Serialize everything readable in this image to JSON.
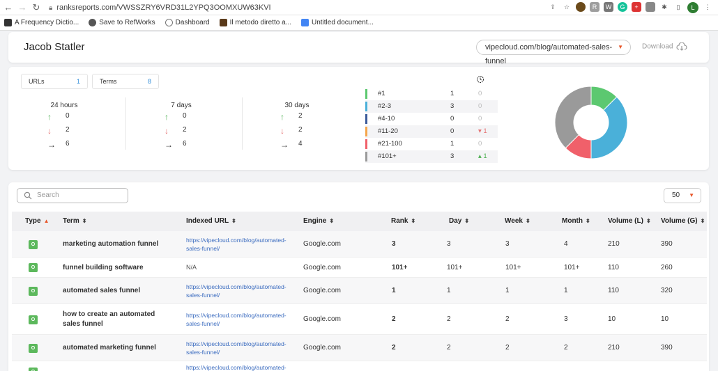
{
  "browser": {
    "url": "ranksreports.com/VWSSZRY6VRD31L2YPQ3OOMXUW63KVI",
    "bookmarks": [
      {
        "label": "A Frequency Dictio...",
        "color": "#333"
      },
      {
        "label": "Save to RefWorks",
        "color": "#555"
      },
      {
        "label": "Dashboard",
        "color": "#777"
      },
      {
        "label": "Il metodo diretto a...",
        "color": "#5a3a1a"
      },
      {
        "label": "Untitled document...",
        "color": "#4285f4"
      }
    ],
    "profile_initial": "L"
  },
  "header": {
    "client_name": "Jacob Statler",
    "url_selected": "vipecloud.com/blog/automated-sales-funnel",
    "download_label": "Download"
  },
  "summary": {
    "urls_label": "URLs",
    "urls_count": "1",
    "terms_label": "Terms",
    "terms_count": "8"
  },
  "periods": [
    {
      "title": "24 hours",
      "up": "0",
      "down": "2",
      "flat": "6"
    },
    {
      "title": "7 days",
      "up": "0",
      "down": "2",
      "flat": "6"
    },
    {
      "title": "30 days",
      "up": "2",
      "down": "2",
      "flat": "4"
    }
  ],
  "rank_buckets": [
    {
      "label": "#1",
      "count": "1",
      "change": "0",
      "dir": "none",
      "color": "#5cc870"
    },
    {
      "label": "#2-3",
      "count": "3",
      "change": "0",
      "dir": "none",
      "color": "#4ab0d9"
    },
    {
      "label": "#4-10",
      "count": "0",
      "change": "0",
      "dir": "none",
      "color": "#3b5a9a"
    },
    {
      "label": "#11-20",
      "count": "0",
      "change": "▾ 1",
      "dir": "neg",
      "color": "#f5a54a"
    },
    {
      "label": "#21-100",
      "count": "1",
      "change": "0",
      "dir": "none",
      "color": "#f0606a"
    },
    {
      "label": "#101+",
      "count": "3",
      "change": "▴ 1",
      "dir": "pos",
      "color": "#9a9a9a"
    }
  ],
  "donut": {
    "segments": [
      {
        "name": "#1",
        "value": 1,
        "color": "#5cc870"
      },
      {
        "name": "#2-3",
        "value": 3,
        "color": "#4ab0d9"
      },
      {
        "name": "#21-100",
        "value": 1,
        "color": "#f0606a"
      },
      {
        "name": "#101+",
        "value": 3,
        "color": "#9a9a9a"
      }
    ]
  },
  "table": {
    "search_placeholder": "Search",
    "per_page": "50",
    "columns": {
      "type": "Type",
      "term": "Term",
      "indexed_url": "Indexed URL",
      "engine": "Engine",
      "rank": "Rank",
      "day": "Day",
      "week": "Week",
      "month": "Month",
      "volume_l": "Volume (L)",
      "volume_g": "Volume (G)"
    },
    "rows": [
      {
        "type": "O",
        "term": "marketing automation funnel",
        "url": "https://vipecloud.com/blog/automated-sales-funnel/",
        "engine": "Google.com",
        "rank": "3",
        "day": "3",
        "week": "3",
        "month": "4",
        "vol_l": "210",
        "vol_g": "390"
      },
      {
        "type": "O",
        "term": "funnel building software",
        "url": "N/A",
        "engine": "Google.com",
        "rank": "101+",
        "day": "101+",
        "week": "101+",
        "month": "101+",
        "vol_l": "110",
        "vol_g": "260"
      },
      {
        "type": "O",
        "term": "automated sales funnel",
        "url": "https://vipecloud.com/blog/automated-sales-funnel/",
        "engine": "Google.com",
        "rank": "1",
        "day": "1",
        "week": "1",
        "month": "1",
        "vol_l": "110",
        "vol_g": "320"
      },
      {
        "type": "O",
        "term": "how to create an automated sales funnel",
        "url": "https://vipecloud.com/blog/automated-sales-funnel/",
        "engine": "Google.com",
        "rank": "2",
        "day": "2",
        "week": "2",
        "month": "3",
        "vol_l": "10",
        "vol_g": "10"
      },
      {
        "type": "O",
        "term": "automated marketing funnel",
        "url": "https://vipecloud.com/blog/automated-sales-funnel/",
        "engine": "Google.com",
        "rank": "2",
        "day": "2",
        "week": "2",
        "month": "2",
        "vol_l": "210",
        "vol_g": "390"
      },
      {
        "type": "O",
        "term": "",
        "url": "https://vipecloud.com/blog/automated-",
        "engine": "",
        "rank": "",
        "day": "",
        "week": "",
        "month": "",
        "vol_l": "",
        "vol_g": ""
      }
    ]
  }
}
